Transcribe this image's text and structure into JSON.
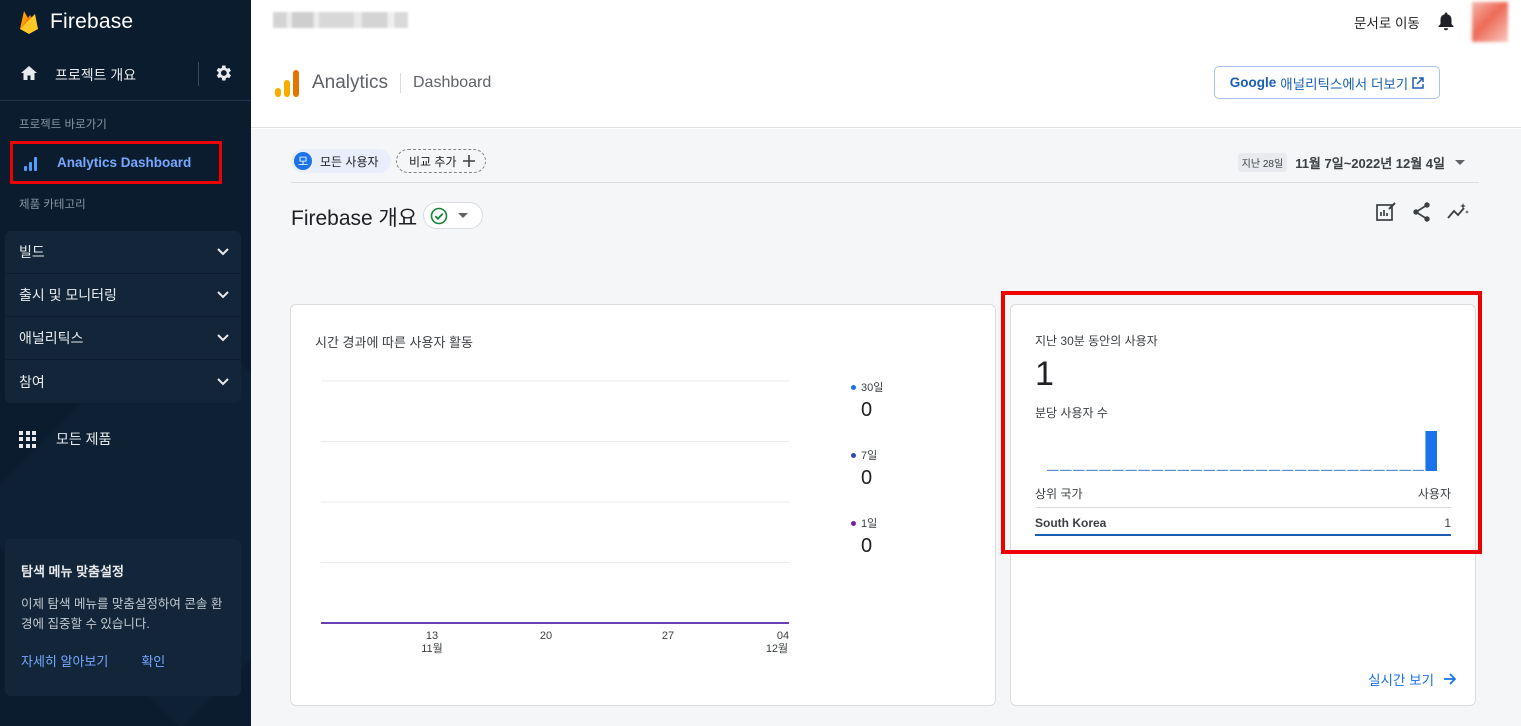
{
  "sidebar": {
    "brand": "Firebase",
    "project_overview": "프로젝트 개요",
    "shortcuts_label": "프로젝트 바로가기",
    "shortcut_item": "Analytics Dashboard",
    "categories_label": "제품 카테고리",
    "categories": [
      {
        "label": "빌드"
      },
      {
        "label": "출시 및 모니터링"
      },
      {
        "label": "애널리틱스"
      },
      {
        "label": "참여"
      }
    ],
    "all_products": "모든 제품",
    "customize": {
      "title": "탐색 메뉴 맞춤설정",
      "description": "이제 탐색 메뉴를 맞춤설정하여 콘솔 환경에 집중할 수 있습니다.",
      "learn_more": "자세히 알아보기",
      "confirm": "확인"
    }
  },
  "header": {
    "docs_link": "문서로 이동",
    "analytics_title": "Analytics",
    "analytics_sub": "Dashboard",
    "ga_button_bold": "Google",
    "ga_button_rest": "애널리틱스에서 더보기"
  },
  "filters": {
    "audience_badge": "모",
    "audience": "모든 사용자",
    "add_comparison": "비교 추가",
    "date_pill": "지난 28일",
    "date_range": "11월 7일~2022년 12월 4일"
  },
  "page_title": "Firebase 개요",
  "activity_card": {
    "title": "시간 경과에 따른 사용자 활동",
    "x_ticks": [
      {
        "top": "13",
        "bottom": "11월"
      },
      {
        "top": "20",
        "bottom": ""
      },
      {
        "top": "27",
        "bottom": ""
      },
      {
        "top": "04",
        "bottom": "12월"
      }
    ],
    "legend": [
      {
        "label": "30일",
        "value": "0",
        "color": "#1a73e8"
      },
      {
        "label": "7일",
        "value": "0",
        "color": "#3949ab"
      },
      {
        "label": "1일",
        "value": "0",
        "color": "#7b1fa2"
      }
    ],
    "line_color": "#6a3fb5"
  },
  "realtime_card": {
    "title": "지난 30분 동안의 사용자",
    "value": "1",
    "per_minute_label": "분당 사용자 수",
    "per_minute_values": [
      0,
      0,
      0,
      0,
      0,
      0,
      0,
      0,
      0,
      0,
      0,
      0,
      0,
      0,
      0,
      0,
      0,
      0,
      0,
      0,
      0,
      0,
      0,
      0,
      0,
      0,
      0,
      0,
      0,
      1
    ],
    "bar_color": "#1a73e8",
    "country_header": "상위 국가",
    "users_header": "사용자",
    "rows": [
      {
        "country": "South Korea",
        "users": "1"
      }
    ],
    "realtime_link": "실시간 보기"
  }
}
